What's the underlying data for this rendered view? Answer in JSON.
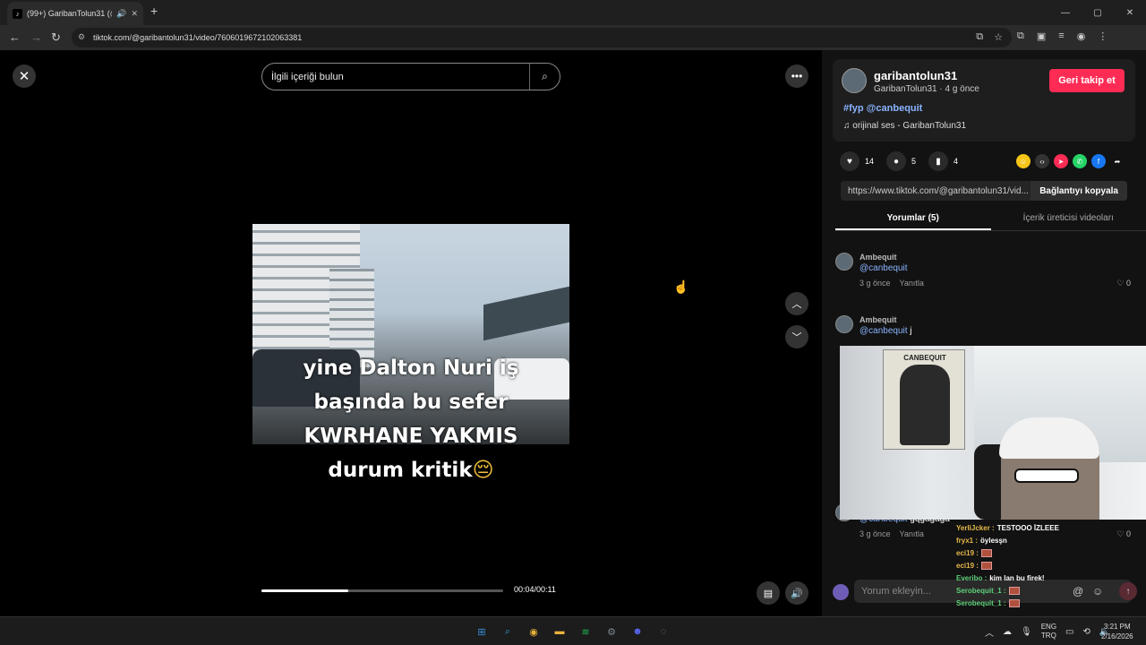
{
  "browser": {
    "tab_title": "(99+) GaribanTolun31 (@ga",
    "tab_favicon": "tiktok-icon",
    "url": "tiktok.com/@garibantolun31/video/7606019672102063381",
    "window_controls": [
      "—",
      "▢",
      "✕"
    ]
  },
  "video": {
    "search_placeholder": "İlgili içeriği bulun",
    "caption_lines": [
      "yine Dalton Nuri iş",
      "başında bu sefer",
      "KWRHANE YAKMIS",
      "durum kritik"
    ],
    "caption_emoji": "😔",
    "time": "00:04/00:11",
    "progress": 0.36
  },
  "author": {
    "username": "garibantolun31",
    "subtitle": "GaribanTolun31 · 4 g önce",
    "follow_label": "Geri takip et",
    "description": "#fyp @canbequit",
    "sound": "orijinal ses - GaribanTolun31"
  },
  "stats": {
    "likes": "14",
    "comments": "5",
    "saves": "4"
  },
  "share": {
    "link": "https://www.tiktok.com/@garibantolun31/vid...",
    "copy_label": "Bağlantıyı kopyala",
    "icons": [
      {
        "name": "coin-icon",
        "color": "#f5c518"
      },
      {
        "name": "embed-icon",
        "color": "#333333"
      },
      {
        "name": "send-icon",
        "color": "#fe2c55"
      },
      {
        "name": "whatsapp-icon",
        "color": "#25d366"
      },
      {
        "name": "facebook-icon",
        "color": "#1877f2"
      },
      {
        "name": "share-arrow-icon",
        "color": "#121212"
      }
    ]
  },
  "tabs": {
    "comments": "Yorumlar (5)",
    "creator_videos": "İçerik üreticisi videoları"
  },
  "comments": [
    {
      "user": "Ambequit",
      "mention": "@canbequit",
      "text": "",
      "time": "3 g önce",
      "reply": "Yanıtla",
      "likes": "0"
    },
    {
      "user": "Ambequit",
      "mention": "@canbequit",
      "text": " j",
      "time": "",
      "reply": "",
      "likes": ""
    },
    {
      "user": "",
      "mention": "@canbequit",
      "text": " gqgagaga",
      "time": "3 g önce",
      "reply": "Yanıtla",
      "likes": "0"
    }
  ],
  "comment_input": {
    "placeholder": "Yorum ekleyin..."
  },
  "webcam": {
    "poster_title": "CANBEQUIT"
  },
  "chat": [
    {
      "user": "YerliJcker",
      "msg": "TESTOOO İZLEEE",
      "color": "#e6b94a",
      "emote": false
    },
    {
      "user": "fryx1",
      "msg": "öylesşn",
      "color": "#e6b94a",
      "emote": false
    },
    {
      "user": "eci19",
      "msg": "",
      "color": "#e6b94a",
      "emote": true
    },
    {
      "user": "eci19",
      "msg": "",
      "color": "#e6b94a",
      "emote": true
    },
    {
      "user": "Everibo",
      "msg": "kim lan bu firek!",
      "color": "#5fd07a",
      "emote": false
    },
    {
      "user": "Serobequit_1",
      "msg": "",
      "color": "#5fd07a",
      "emote": true
    },
    {
      "user": "Serobequit_1",
      "msg": "",
      "color": "#5fd07a",
      "emote": true
    }
  ],
  "taskbar": {
    "lang_top": "ENG",
    "lang_bottom": "TRQ",
    "time": "3:21 PM",
    "date": "2/16/2026",
    "apps": [
      {
        "name": "windows-start-icon",
        "color": "#3a8fe0"
      },
      {
        "name": "search-icon",
        "color": "#2f9fd1"
      },
      {
        "name": "chrome-icon",
        "color": "#e9b33a"
      },
      {
        "name": "file-explorer-icon",
        "color": "#e8b23c"
      },
      {
        "name": "spotify-icon",
        "color": "#1db954"
      },
      {
        "name": "settings-icon",
        "color": "#7b8794"
      },
      {
        "name": "discord-icon",
        "color": "#5865f2"
      },
      {
        "name": "app-icon",
        "color": "#8a8a8a"
      }
    ]
  }
}
